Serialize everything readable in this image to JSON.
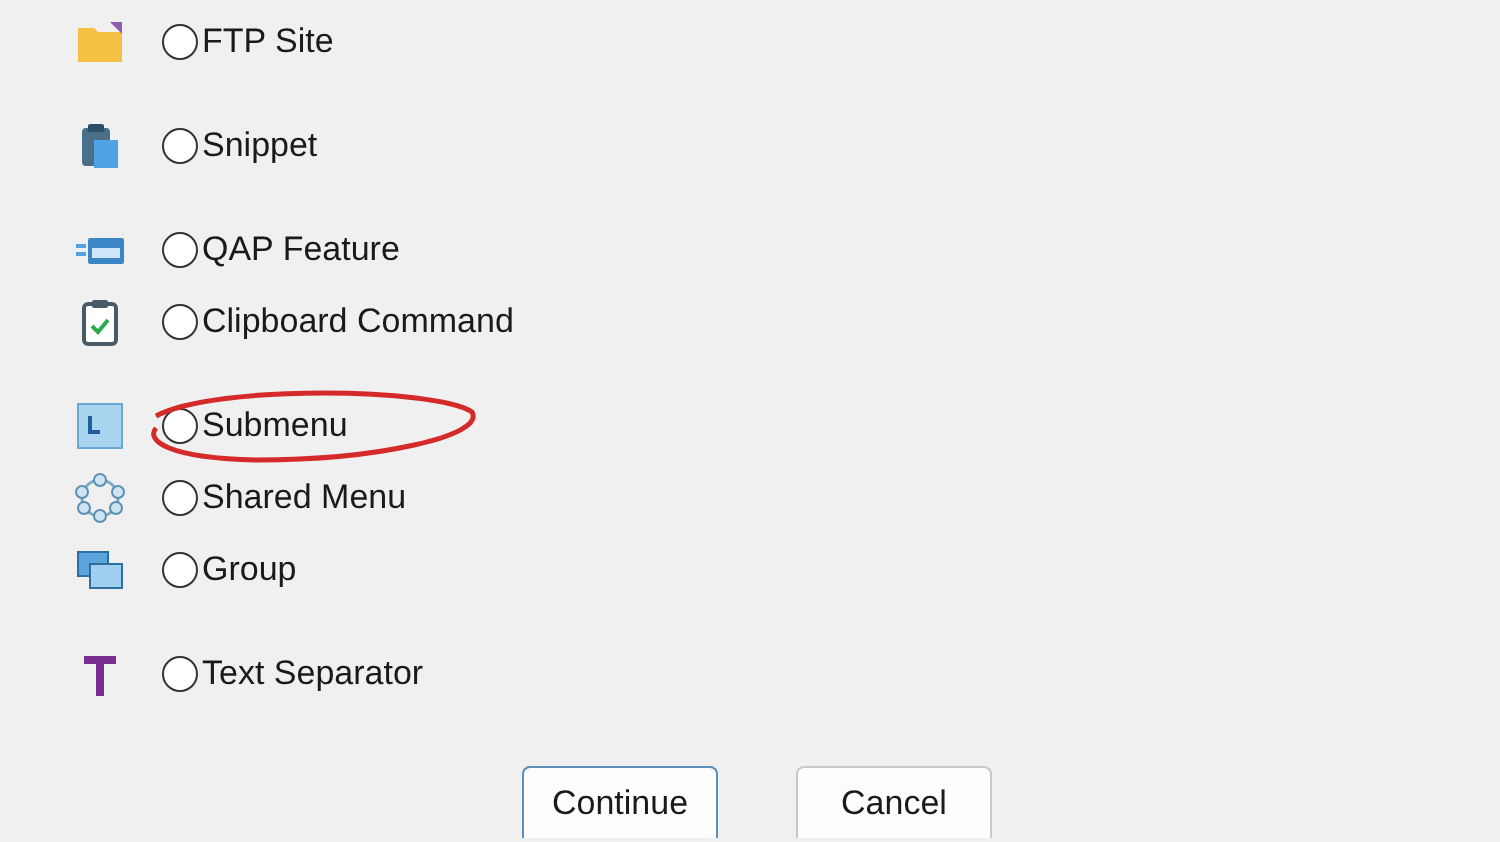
{
  "options": [
    {
      "kind": "folder",
      "label": "FTP Site",
      "selected": false,
      "highlighted": false
    },
    {
      "kind": "snippet",
      "label": "Snippet",
      "selected": false,
      "highlighted": false
    },
    {
      "kind": "feature",
      "label": "QAP Feature",
      "selected": false,
      "highlighted": false
    },
    {
      "kind": "command",
      "label": "Clipboard Command",
      "selected": false,
      "highlighted": false
    },
    {
      "kind": "submenu",
      "label": "Submenu",
      "selected": false,
      "highlighted": true
    },
    {
      "kind": "shared",
      "label": "Shared Menu",
      "selected": false,
      "highlighted": false
    },
    {
      "kind": "group",
      "label": "Group",
      "selected": false,
      "highlighted": false
    },
    {
      "kind": "separator",
      "label": "Text Separator",
      "selected": false,
      "highlighted": false
    }
  ],
  "buttons": [
    {
      "label": "Continue",
      "default": true
    },
    {
      "label": "Cancel",
      "default": false
    }
  ]
}
